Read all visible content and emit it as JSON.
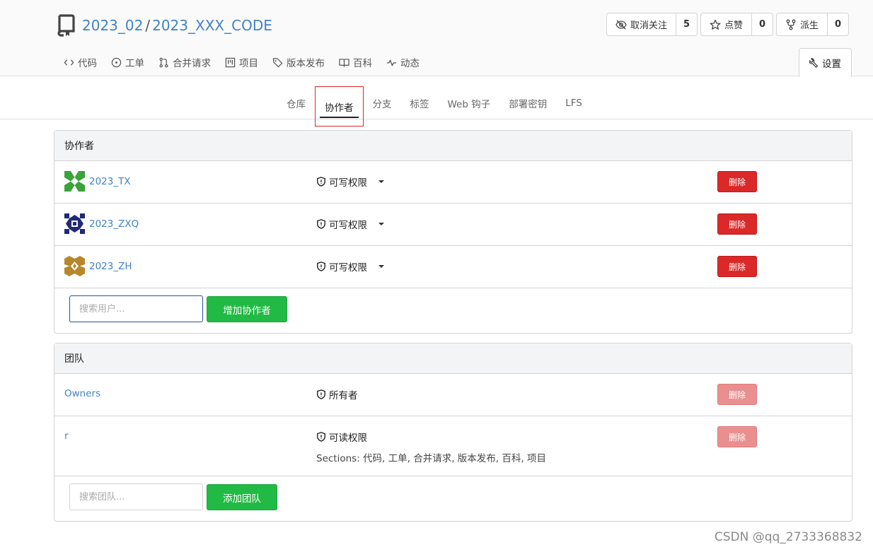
{
  "repo": {
    "owner": "2023_02",
    "separator": "/",
    "name": "2023_XXX_CODE"
  },
  "actions": [
    {
      "label": "取消关注",
      "count": "5",
      "icon": "eye-slash-icon"
    },
    {
      "label": "点赞",
      "count": "0",
      "icon": "star-icon"
    },
    {
      "label": "派生",
      "count": "0",
      "icon": "fork-icon"
    }
  ],
  "repo_tabs": [
    {
      "label": "代码",
      "icon": "code-icon"
    },
    {
      "label": "工单",
      "icon": "issue-icon"
    },
    {
      "label": "合并请求",
      "icon": "pull-request-icon"
    },
    {
      "label": "项目",
      "icon": "project-icon"
    },
    {
      "label": "版本发布",
      "icon": "tag-icon"
    },
    {
      "label": "百科",
      "icon": "book-icon"
    },
    {
      "label": "动态",
      "icon": "pulse-icon"
    }
  ],
  "settings_tab": {
    "label": "设置",
    "icon": "tools-icon"
  },
  "sub_tabs": [
    "仓库",
    "协作者",
    "分支",
    "标签",
    "Web 钩子",
    "部署密钥",
    "LFS"
  ],
  "active_sub_tab": "协作者",
  "collaborators": {
    "heading": "协作者",
    "rows": [
      {
        "name": "2023_TX",
        "permission": "可写权限",
        "delete": "删除",
        "avatar_color": "#3aa33a"
      },
      {
        "name": "2023_ZXQ",
        "permission": "可写权限",
        "delete": "删除",
        "avatar_color": "#1f2a7a"
      },
      {
        "name": "2023_ZH",
        "permission": "可写权限",
        "delete": "删除",
        "avatar_color": "#b8862b"
      }
    ],
    "search_placeholder": "搜索用户...",
    "add_button": "增加协作者"
  },
  "teams": {
    "heading": "团队",
    "rows": [
      {
        "name": "Owners",
        "permission": "所有者",
        "delete": "删除",
        "sections": ""
      },
      {
        "name": "r",
        "permission": "可读权限",
        "delete": "删除",
        "sections": "Sections: 代码, 工单, 合并请求, 版本发布, 百科, 项目"
      }
    ],
    "search_placeholder": "搜索团队...",
    "add_button": "添加团队"
  },
  "watermark": "CSDN @qq_2733368832",
  "colors": {
    "link": "#4183c4",
    "danger": "#db2828",
    "success": "#21ba45",
    "active_outline": "#db2828"
  }
}
